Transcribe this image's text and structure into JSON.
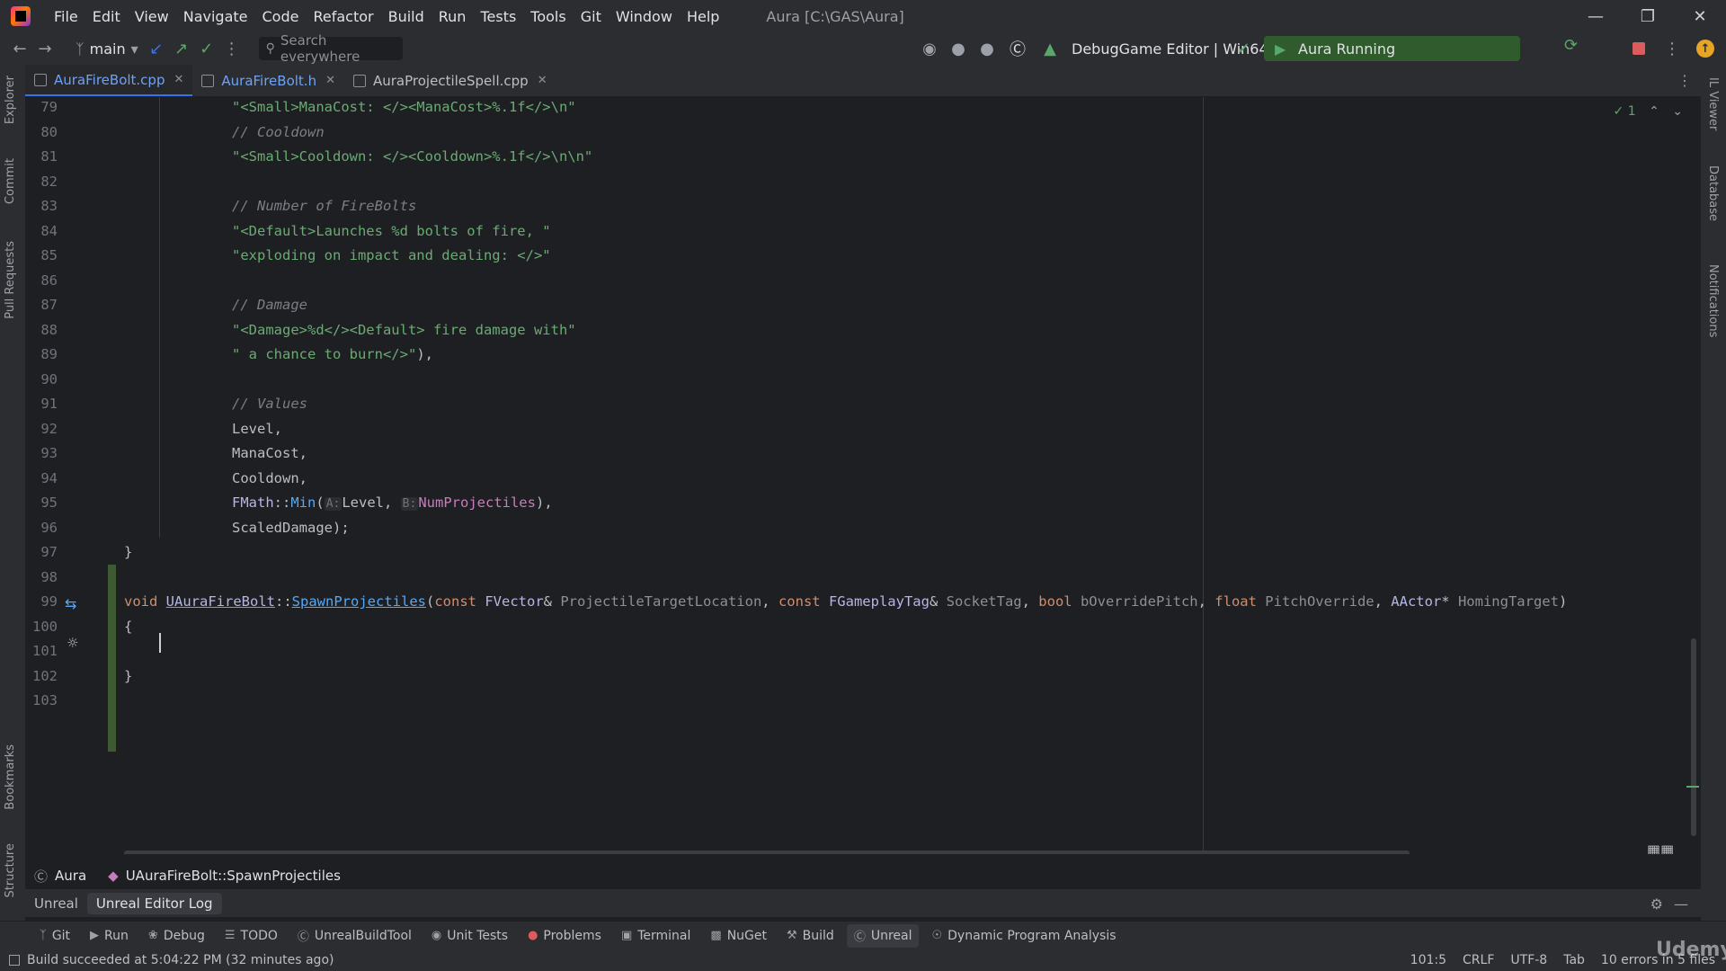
{
  "menu": {
    "items": [
      "File",
      "Edit",
      "View",
      "Navigate",
      "Code",
      "Refactor",
      "Build",
      "Run",
      "Tests",
      "Tools",
      "Git",
      "Window",
      "Help"
    ],
    "title": "Aura [C:\\GAS\\Aura]"
  },
  "toolbar": {
    "branch": "main",
    "search_placeholder": "Search everywhere",
    "run_config": "DebugGame Editor | Win64",
    "run_status": "Aura Running"
  },
  "tabs": [
    {
      "name": "AuraFireBolt.cpp",
      "active": true
    },
    {
      "name": "AuraFireBolt.h",
      "active": false
    },
    {
      "name": "AuraProjectileSpell.cpp",
      "active": false
    }
  ],
  "inspection": {
    "count": "1"
  },
  "editor": {
    "line_numbers": [
      "79",
      "80",
      "81",
      "82",
      "83",
      "84",
      "85",
      "86",
      "87",
      "88",
      "89",
      "90",
      "91",
      "92",
      "93",
      "94",
      "95",
      "96",
      "97",
      "98",
      "99",
      "100",
      "101",
      "102",
      "103"
    ],
    "lines": {
      "l79": "\"<Small>ManaCost: </><ManaCost>%.1f</>\\n\"",
      "l80": "// Cooldown",
      "l81": "\"<Small>Cooldown: </><Cooldown>%.1f</>\\n\\n\"",
      "l83": "// Number of FireBolts",
      "l84": "\"<Default>Launches %d bolts of fire, \"",
      "l85": "\"exploding on impact and dealing: </>\"",
      "l87": "// Damage",
      "l88": "\"<Damage>%d</><Default> fire damage with\"",
      "l89": "\" a chance to burn</>\"",
      "l89_tail": "),",
      "l91": "// Values",
      "l92": "Level,",
      "l93": "ManaCost,",
      "l94": "Cooldown,",
      "l95_a": "FMath",
      "l95_b": "::",
      "l95_c": "Min",
      "l95_d": "(",
      "l95_hint_a": "A:",
      "l95_e": "Level, ",
      "l95_hint_b": "B:",
      "l95_f": "NumProjectiles",
      "l95_g": "),",
      "l96": "ScaledDamage);",
      "l97": "}",
      "l99_void": "void ",
      "l99_class": "UAuraFireBolt",
      "l99_sep": "::",
      "l99_fn": "SpawnProjectiles",
      "l99_open": "(",
      "l99_const1": "const ",
      "l99_t1": "FVector",
      "l99_amp1": "& ",
      "l99_p1": "ProjectileTargetLocation",
      "l99_c1": ", ",
      "l99_const2": "const ",
      "l99_t2": "FGameplayTag",
      "l99_amp2": "& ",
      "l99_p2": "SocketTag",
      "l99_c2": ", ",
      "l99_bool": "bool ",
      "l99_p3": "bOverridePitch",
      "l99_c3": ", ",
      "l99_float": "float ",
      "l99_p4": "PitchOverride",
      "l99_c4": ", ",
      "l99_t5": "AActor",
      "l99_star": "* ",
      "l99_p5": "HomingTarget",
      "l99_close": ")",
      "l100": "{",
      "l102": "}"
    }
  },
  "breadcrumbs": [
    "Aura",
    "UAuraFireBolt::SpawnProjectiles"
  ],
  "bottom_panel": {
    "tabs": [
      "Unreal",
      "Unreal Editor Log"
    ]
  },
  "tool_windows": [
    "Git",
    "Run",
    "Debug",
    "TODO",
    "UnrealBuildTool",
    "Unit Tests",
    "Problems",
    "Terminal",
    "NuGet",
    "Build",
    "Unreal",
    "Dynamic Program Analysis"
  ],
  "side_tools": {
    "left": [
      "Explorer",
      "Commit",
      "Pull Requests",
      "Bookmarks",
      "Structure"
    ],
    "right": [
      "IL Viewer",
      "Database",
      "Notifications"
    ]
  },
  "status": {
    "message": "Build succeeded at 5:04:22 PM (32 minutes ago)",
    "position": "101:5",
    "line_ending": "CRLF",
    "encoding": "UTF-8",
    "indent": "Tab",
    "errors": "10 errors in 5 files"
  },
  "watermark": "Udemy"
}
